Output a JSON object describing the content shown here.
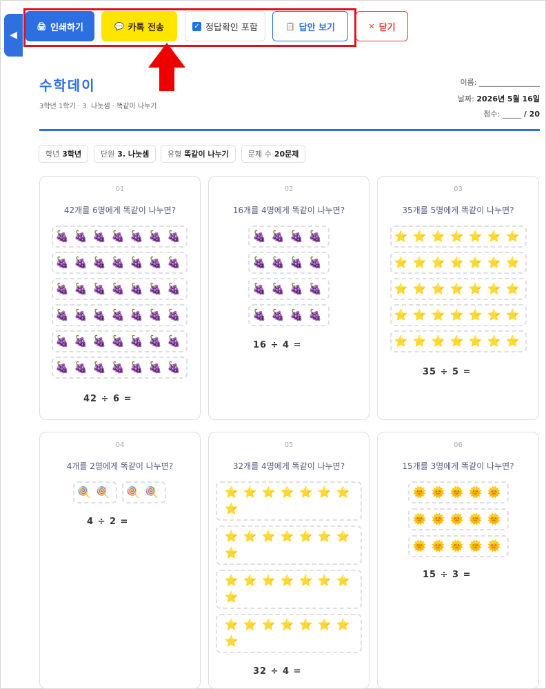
{
  "sidebar_toggle": "◀",
  "toolbar": {
    "print_label": "인쇄하기",
    "kakao_label": "카톡 전송",
    "include_answers_label": "정답확인 포함",
    "include_answers_checked": true,
    "show_answers_label": "답안 보기",
    "close_label": "닫기"
  },
  "header": {
    "title": "수학데이",
    "subtitle": "3학년 1학기 · 3. 나눗셈 · 똑같이 나누기",
    "name_label": "이름:",
    "name_blank": "________________",
    "date_label": "날짜:",
    "date_value": "2026년 5월 16일",
    "score_label": "점수:",
    "score_blank": "_____",
    "score_total": "/ 20"
  },
  "chips": [
    {
      "label": "학년",
      "value": "3학년"
    },
    {
      "label": "단원",
      "value": "3. 나눗셈"
    },
    {
      "label": "유형",
      "value": "똑같이 나누기"
    },
    {
      "label": "문제 수",
      "value": "20문제"
    }
  ],
  "problems": [
    {
      "num": "01",
      "text": "42개를 6명에게 똑같이 나누면?",
      "icon": "grape",
      "groups": 6,
      "per_group": 7,
      "equation": "42 ÷ 6 ="
    },
    {
      "num": "02",
      "text": "16개를 4명에게 똑같이 나누면?",
      "icon": "grape",
      "groups": 4,
      "per_group": 4,
      "equation": "16 ÷ 4 ="
    },
    {
      "num": "03",
      "text": "35개를 5명에게 똑같이 나누면?",
      "icon": "star",
      "groups": 5,
      "per_group": 7,
      "equation": "35 ÷ 5 ="
    },
    {
      "num": "04",
      "text": "4개를 2명에게 똑같이 나누면?",
      "icon": "lollipop",
      "groups": 2,
      "per_group": 2,
      "equation": "4 ÷ 2 ="
    },
    {
      "num": "05",
      "text": "32개를 4명에게 똑같이 나누면?",
      "icon": "star",
      "groups": 4,
      "per_group": 8,
      "equation": "32 ÷ 4 ="
    },
    {
      "num": "06",
      "text": "15개를 3명에게 똑같이 나누면?",
      "icon": "sun",
      "groups": 3,
      "per_group": 5,
      "equation": "15 ÷ 3 ="
    }
  ],
  "icon_glyphs": {
    "grape": "🍇",
    "star": "⭐",
    "lollipop": "🍭",
    "sun": "🌞"
  },
  "colors": {
    "accent": "#2b6fe3",
    "kakao": "#fee500",
    "highlight": "#e0101b",
    "close": "#e03a3a"
  }
}
